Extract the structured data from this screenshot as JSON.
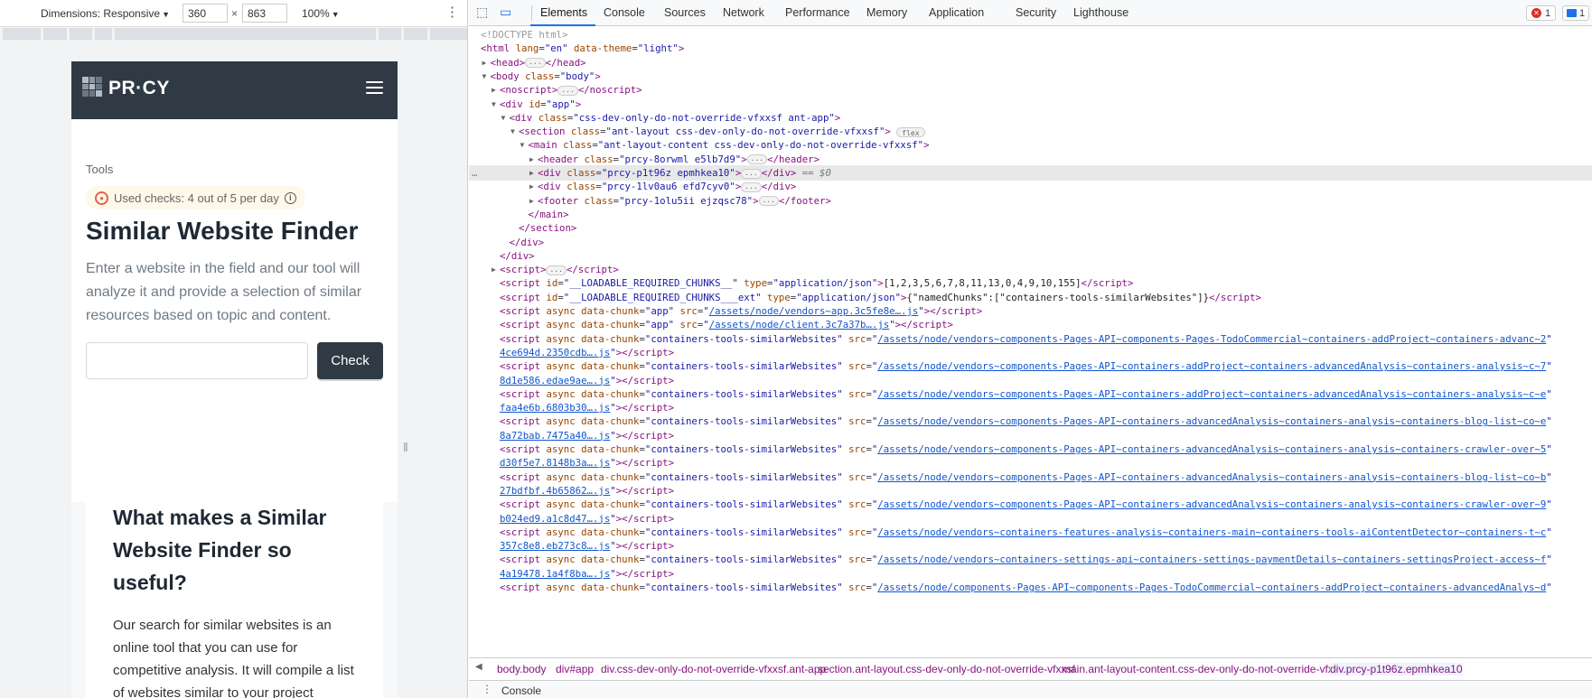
{
  "device_toolbar": {
    "dimensions_label": "Dimensions: Responsive",
    "width": "360",
    "height": "863",
    "times": "×",
    "zoom": "100%"
  },
  "site": {
    "brand": "PR·CY",
    "breadcrumb": "Tools",
    "checks_text": "Used checks: 4 out of 5 per day",
    "title": "Similar Website Finder",
    "description": "Enter a website in the field and our tool will analyze it and provide a selection of similar resources based on topic and content.",
    "input_value": "",
    "check_label": "Check",
    "card_title": "What makes a Similar Website Finder so useful?",
    "card_body": "Our search for similar websites is an online tool that you can use for competitive analysis. It will compile a list of websites similar to your project"
  },
  "devtools": {
    "tabs": [
      "Elements",
      "Console",
      "Sources",
      "Network",
      "Performance",
      "Memory",
      "Application",
      "Security",
      "Lighthouse"
    ],
    "active_tab": "Elements",
    "errors": "1",
    "messages": "1",
    "tree": [
      {
        "d": 0,
        "t": "",
        "h": "<span class='cm'>&lt;!DOCTYPE html&gt;</span>"
      },
      {
        "d": 0,
        "t": "",
        "h": "<span class='tg'>&lt;html</span> <span class='an'>lang</span>=<span class='av'>\"en\"</span> <span class='an'>data-theme</span>=<span class='av'>\"light\"</span><span class='tg'>&gt;</span>"
      },
      {
        "d": 1,
        "t": "c",
        "h": "<span class='tg'>&lt;head&gt;</span><span class='pill'>···</span><span class='tg'>&lt;/head&gt;</span>"
      },
      {
        "d": 1,
        "t": "o",
        "h": "<span class='tg'>&lt;body</span> <span class='an'>class</span>=<span class='av'>\"body\"</span><span class='tg'>&gt;</span>"
      },
      {
        "d": 2,
        "t": "c",
        "h": "<span class='tg'>&lt;noscript&gt;</span><span class='pill'>···</span><span class='tg'>&lt;/noscript&gt;</span>"
      },
      {
        "d": 2,
        "t": "o",
        "h": "<span class='tg'>&lt;div</span> <span class='an'>id</span>=<span class='av'>\"app\"</span><span class='tg'>&gt;</span>"
      },
      {
        "d": 3,
        "t": "o",
        "h": "<span class='tg'>&lt;div</span> <span class='an'>class</span>=<span class='av'>\"css-dev-only-do-not-override-vfxxsf ant-app\"</span><span class='tg'>&gt;</span>"
      },
      {
        "d": 4,
        "t": "o",
        "h": "<span class='tg'>&lt;section</span> <span class='an'>class</span>=<span class='av'>\"ant-layout css-dev-only-do-not-override-vfxxsf\"</span><span class='tg'>&gt;</span> <span class='pill flex'>flex</span>"
      },
      {
        "d": 5,
        "t": "o",
        "h": "<span class='tg'>&lt;main</span> <span class='an'>class</span>=<span class='av'>\"ant-layout-content css-dev-only-do-not-override-vfxxsf\"</span><span class='tg'>&gt;</span>"
      },
      {
        "d": 6,
        "t": "c",
        "h": "<span class='tg'>&lt;header</span> <span class='an'>class</span>=<span class='av'>\"prcy-8orwml e5lb7d9\"</span><span class='tg'>&gt;</span><span class='pill'>···</span><span class='tg'>&lt;/header&gt;</span>"
      },
      {
        "d": 6,
        "t": "c",
        "sel": true,
        "h": "<span class='tg'>&lt;div</span> <span class='an'>class</span>=<span class='av'>\"prcy-p1t96z epmhkea10\"</span><span class='tg'>&gt;</span><span class='pill'>···</span><span class='tg'>&lt;/div&gt;</span> <span class='eq'>== $0</span>"
      },
      {
        "d": 6,
        "t": "c",
        "h": "<span class='tg'>&lt;div</span> <span class='an'>class</span>=<span class='av'>\"prcy-1lv0au6 efd7cyv0\"</span><span class='tg'>&gt;</span><span class='pill'>···</span><span class='tg'>&lt;/div&gt;</span>"
      },
      {
        "d": 6,
        "t": "c",
        "h": "<span class='tg'>&lt;footer</span> <span class='an'>class</span>=<span class='av'>\"prcy-1olu5ii ejzqsc78\"</span><span class='tg'>&gt;</span><span class='pill'>···</span><span class='tg'>&lt;/footer&gt;</span>"
      },
      {
        "d": 5,
        "t": "",
        "h": "<span class='tg'>&lt;/main&gt;</span>"
      },
      {
        "d": 4,
        "t": "",
        "h": "<span class='tg'>&lt;/section&gt;</span>"
      },
      {
        "d": 3,
        "t": "",
        "h": "<span class='tg'>&lt;/div&gt;</span>"
      },
      {
        "d": 2,
        "t": "",
        "h": "<span class='tg'>&lt;/div&gt;</span>"
      },
      {
        "d": 2,
        "t": "c",
        "h": "<span class='tg'>&lt;script&gt;</span><span class='pill'>···</span><span class='tg'>&lt;/script&gt;</span>"
      },
      {
        "d": 2,
        "t": "",
        "h": "<span class='tg'>&lt;script</span> <span class='an'>id</span>=<span class='av'>\"__LOADABLE_REQUIRED_CHUNKS__\"</span> <span class='an'>type</span>=<span class='av'>\"application/json\"</span><span class='tg'>&gt;</span><span class='tx'>[1,2,3,5,6,7,8,11,13,0,4,9,10,155]</span><span class='tg'>&lt;/script&gt;</span>"
      },
      {
        "d": 2,
        "t": "",
        "h": "<span class='tg'>&lt;script</span> <span class='an'>id</span>=<span class='av'>\"__LOADABLE_REQUIRED_CHUNKS___ext\"</span> <span class='an'>type</span>=<span class='av'>\"application/json\"</span><span class='tg'>&gt;</span><span class='tx'>{\"namedChunks\":[\"containers-tools-similarWebsites\"]}</span><span class='tg'>&lt;/script&gt;</span>"
      },
      {
        "d": 2,
        "t": "",
        "h": "<span class='tg'>&lt;script</span> <span class='an'>async</span> <span class='an'>data-chunk</span>=<span class='av'>\"app\"</span> <span class='an'>src</span>=<span class='av'>\"<span class='lk'>/assets/node/vendors~app.3c5fe8e….js</span>\"</span><span class='tg'>&gt;&lt;/script&gt;</span>"
      },
      {
        "d": 2,
        "t": "",
        "h": "<span class='tg'>&lt;script</span> <span class='an'>async</span> <span class='an'>data-chunk</span>=<span class='av'>\"app\"</span> <span class='an'>src</span>=<span class='av'>\"<span class='lk'>/assets/node/client.3c7a37b….js</span>\"</span><span class='tg'>&gt;&lt;/script&gt;</span>"
      },
      {
        "d": 2,
        "t": "",
        "h": "<span class='tg'>&lt;script</span> <span class='an'>async</span> <span class='an'>data-chunk</span>=<span class='av'>\"containers-tools-similarWebsites\"</span> <span class='an'>src</span>=<span class='av'>\"<span class='lk'>/assets/node/vendors~components-Pages-API~components-Pages-TodoCommercial~containers-addProject~containers-advanc~2</span>\"</span>"
      },
      {
        "d": 2,
        "t": "",
        "h": "<span class='av'><span class='lk'>4ce694d.2350cdb….js</span>\"</span><span class='tg'>&gt;&lt;/script&gt;</span>"
      },
      {
        "d": 2,
        "t": "",
        "h": "<span class='tg'>&lt;script</span> <span class='an'>async</span> <span class='an'>data-chunk</span>=<span class='av'>\"containers-tools-similarWebsites\"</span> <span class='an'>src</span>=<span class='av'>\"<span class='lk'>/assets/node/vendors~components-Pages-API~containers-addProject~containers-advancedAnalysis~containers-analysis~c~7</span>\"</span>"
      },
      {
        "d": 2,
        "t": "",
        "h": "<span class='av'><span class='lk'>8d1e586.edae9ae….js</span>\"</span><span class='tg'>&gt;&lt;/script&gt;</span>"
      },
      {
        "d": 2,
        "t": "",
        "h": "<span class='tg'>&lt;script</span> <span class='an'>async</span> <span class='an'>data-chunk</span>=<span class='av'>\"containers-tools-similarWebsites\"</span> <span class='an'>src</span>=<span class='av'>\"<span class='lk'>/assets/node/vendors~components-Pages-API~containers-addProject~containers-advancedAnalysis~containers-analysis~c~e</span>\"</span>"
      },
      {
        "d": 2,
        "t": "",
        "h": "<span class='av'><span class='lk'>faa4e6b.6803b30….js</span>\"</span><span class='tg'>&gt;&lt;/script&gt;</span>"
      },
      {
        "d": 2,
        "t": "",
        "h": "<span class='tg'>&lt;script</span> <span class='an'>async</span> <span class='an'>data-chunk</span>=<span class='av'>\"containers-tools-similarWebsites\"</span> <span class='an'>src</span>=<span class='av'>\"<span class='lk'>/assets/node/vendors~components-Pages-API~containers-advancedAnalysis~containers-analysis~containers-blog-list~co~e</span>\"</span>"
      },
      {
        "d": 2,
        "t": "",
        "h": "<span class='av'><span class='lk'>8a72bab.7475a40….js</span>\"</span><span class='tg'>&gt;&lt;/script&gt;</span>"
      },
      {
        "d": 2,
        "t": "",
        "h": "<span class='tg'>&lt;script</span> <span class='an'>async</span> <span class='an'>data-chunk</span>=<span class='av'>\"containers-tools-similarWebsites\"</span> <span class='an'>src</span>=<span class='av'>\"<span class='lk'>/assets/node/vendors~components-Pages-API~containers-advancedAnalysis~containers-analysis~containers-crawler-over~5</span>\"</span>"
      },
      {
        "d": 2,
        "t": "",
        "h": "<span class='av'><span class='lk'>d30f5e7.8148b3a….js</span>\"</span><span class='tg'>&gt;&lt;/script&gt;</span>"
      },
      {
        "d": 2,
        "t": "",
        "h": "<span class='tg'>&lt;script</span> <span class='an'>async</span> <span class='an'>data-chunk</span>=<span class='av'>\"containers-tools-similarWebsites\"</span> <span class='an'>src</span>=<span class='av'>\"<span class='lk'>/assets/node/vendors~components-Pages-API~containers-advancedAnalysis~containers-analysis~containers-blog-list~co~b</span>\"</span>"
      },
      {
        "d": 2,
        "t": "",
        "h": "<span class='av'><span class='lk'>27bdfbf.4b65862….js</span>\"</span><span class='tg'>&gt;&lt;/script&gt;</span>"
      },
      {
        "d": 2,
        "t": "",
        "h": "<span class='tg'>&lt;script</span> <span class='an'>async</span> <span class='an'>data-chunk</span>=<span class='av'>\"containers-tools-similarWebsites\"</span> <span class='an'>src</span>=<span class='av'>\"<span class='lk'>/assets/node/vendors~components-Pages-API~containers-advancedAnalysis~containers-analysis~containers-crawler-over~9</span>\"</span>"
      },
      {
        "d": 2,
        "t": "",
        "h": "<span class='av'><span class='lk'>b024ed9.a1c8d47….js</span>\"</span><span class='tg'>&gt;&lt;/script&gt;</span>"
      },
      {
        "d": 2,
        "t": "",
        "h": "<span class='tg'>&lt;script</span> <span class='an'>async</span> <span class='an'>data-chunk</span>=<span class='av'>\"containers-tools-similarWebsites\"</span> <span class='an'>src</span>=<span class='av'>\"<span class='lk'>/assets/node/vendors~containers-features-analysis~containers-main~containers-tools-aiContentDetector~containers-t~c</span>\"</span>"
      },
      {
        "d": 2,
        "t": "",
        "h": "<span class='av'><span class='lk'>357c8e8.eb273c8….js</span>\"</span><span class='tg'>&gt;&lt;/script&gt;</span>"
      },
      {
        "d": 2,
        "t": "",
        "h": "<span class='tg'>&lt;script</span> <span class='an'>async</span> <span class='an'>data-chunk</span>=<span class='av'>\"containers-tools-similarWebsites\"</span> <span class='an'>src</span>=<span class='av'>\"<span class='lk'>/assets/node/vendors~containers-settings-api~containers-settings-paymentDetails~containers-settingsProject-access~f</span>\"</span>"
      },
      {
        "d": 2,
        "t": "",
        "h": "<span class='av'><span class='lk'>4a19478.1a4f8ba….js</span>\"</span><span class='tg'>&gt;&lt;/script&gt;</span>"
      },
      {
        "d": 2,
        "t": "",
        "h": "<span class='tg'>&lt;script</span> <span class='an'>async</span> <span class='an'>data-chunk</span>=<span class='av'>\"containers-tools-similarWebsites\"</span> <span class='an'>src</span>=<span class='av'>\"<span class='lk'>/assets/node/components-Pages-API~components-Pages-TodoCommercial~containers-addProject~containers-advancedAnalys~d</span>\"</span>"
      }
    ],
    "breadcrumbs": [
      "body.body",
      "div#app",
      "div.css-dev-only-do-not-override-vfxxsf.ant-app",
      "section.ant-layout.css-dev-only-do-not-override-vfxxsf",
      "main.ant-layout-content.css-dev-only-do-not-override-vfxxsf",
      "div.prcy-p1t96z.epmhkea10"
    ],
    "drawer_label": "Console"
  }
}
